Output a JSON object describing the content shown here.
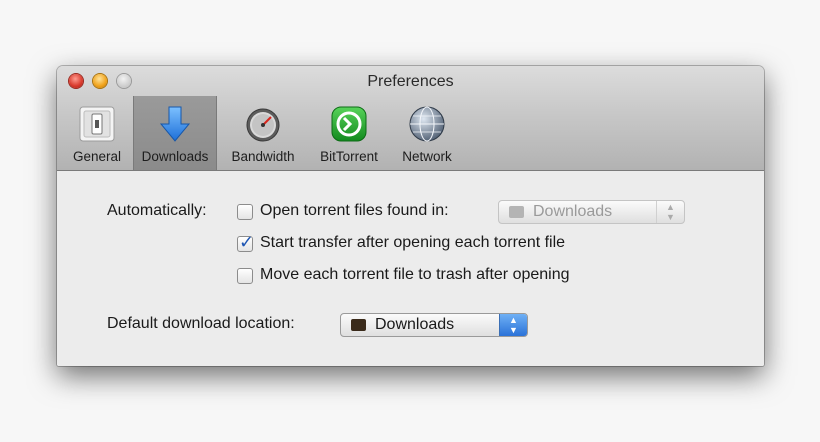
{
  "window": {
    "title": "Preferences"
  },
  "toolbar": {
    "tabs": [
      {
        "label": "General",
        "icon": "general-switch-icon",
        "selected": false
      },
      {
        "label": "Downloads",
        "icon": "download-arrow-icon",
        "selected": true
      },
      {
        "label": "Bandwidth",
        "icon": "speedometer-icon",
        "selected": false
      },
      {
        "label": "BitTorrent",
        "icon": "bittorrent-logo-icon",
        "selected": false
      },
      {
        "label": "Network",
        "icon": "globe-icon",
        "selected": false
      }
    ]
  },
  "downloads": {
    "automatically_label": "Automatically:",
    "options": [
      {
        "label": "Open torrent files found in:",
        "checked": false
      },
      {
        "label": "Start transfer after opening each torrent file",
        "checked": true
      },
      {
        "label": "Move each torrent file to trash after opening",
        "checked": false
      }
    ],
    "watch_folder": {
      "value": "Downloads",
      "enabled": false
    },
    "default_location_label": "Default download location:",
    "default_location": {
      "value": "Downloads",
      "enabled": true
    }
  },
  "colors": {
    "accent": "#2a72d8",
    "check": "#1e56b3"
  }
}
